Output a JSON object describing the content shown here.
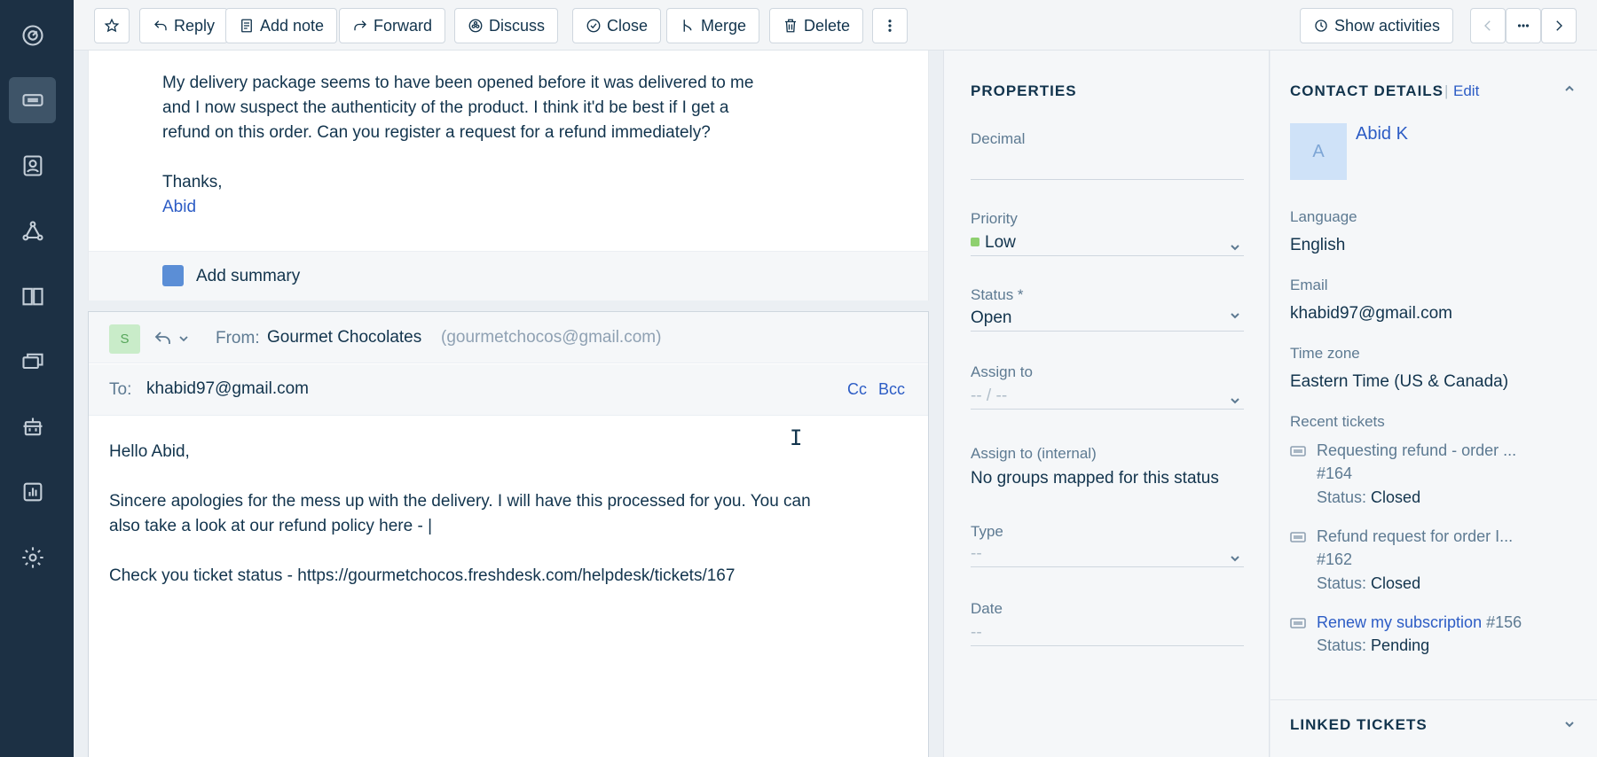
{
  "toolbar": {
    "reply": "Reply",
    "add_note": "Add note",
    "forward": "Forward",
    "discuss": "Discuss",
    "close": "Close",
    "merge": "Merge",
    "delete": "Delete",
    "show_activities": "Show activities"
  },
  "message": {
    "lines": [
      "My delivery package seems to have been opened before it was delivered to me",
      "and I now suspect the authenticity of the product. I think it'd be best if I get a",
      "refund on this order. Can you register a request for a refund immediately?",
      "Thanks,",
      "Abid"
    ],
    "add_summary": "Add summary"
  },
  "reply": {
    "avatar_letter": "S",
    "from_label": "From:",
    "from_name": "Gourmet Chocolates",
    "from_email": "(gourmetchocos@gmail.com)",
    "to_label": "To:",
    "to_value": "khabid97@gmail.com",
    "cc": "Cc",
    "bcc": "Bcc",
    "body": [
      "Hello Abid,",
      "Sincere apologies for the mess up with the delivery. I will have this processed for you. You can",
      "also take a look at our refund policy here - |",
      "Check you ticket status - https://gourmetchocos.freshdesk.com/helpdesk/tickets/167"
    ]
  },
  "properties": {
    "title": "PROPERTIES",
    "decimal_label": "Decimal",
    "decimal_value": "",
    "priority_label": "Priority",
    "priority_value": "Low",
    "status_label": "Status *",
    "status_value": "Open",
    "assign_label": "Assign to",
    "assign_value": "-- / --",
    "assign_internal_label": "Assign to (internal)",
    "assign_internal_value": "No groups mapped for this status",
    "type_label": "Type",
    "type_value": "--",
    "date_label": "Date",
    "date_value": "--",
    "colors": {
      "priority_low": "#8ed06f"
    }
  },
  "contact": {
    "title": "CONTACT DETAILS",
    "separator": "|",
    "edit": "Edit",
    "avatar_letter": "A",
    "name": "Abid K",
    "language_label": "Language",
    "language_value": "English",
    "email_label": "Email",
    "email_value": "khabid97@gmail.com",
    "timezone_label": "Time zone",
    "timezone_value": "Eastern Time (US & Canada)",
    "recent_label": "Recent tickets",
    "tickets": [
      {
        "title": "Requesting refund - order ...",
        "id": "#164",
        "status_label": "Status:",
        "status": "Closed"
      },
      {
        "title": "Refund request for order I...",
        "id": "#162",
        "status_label": "Status:",
        "status": "Closed"
      },
      {
        "title": "Renew my subscription",
        "id": "#156",
        "status_label": "Status:",
        "status": "Pending"
      }
    ],
    "linked_title": "LINKED TICKETS"
  }
}
